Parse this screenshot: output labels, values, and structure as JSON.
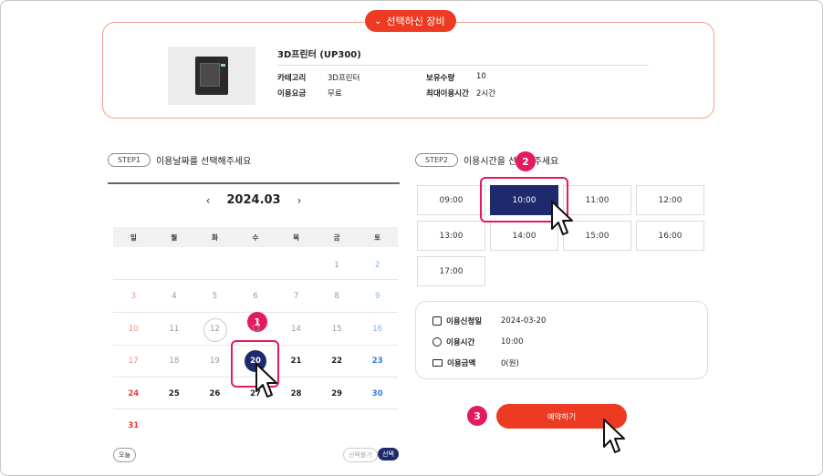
{
  "equipment": {
    "header": "선택하신 장비",
    "name": "3D프린터 (UP300)",
    "fields": {
      "category_label": "카테고리",
      "category_value": "3D프린터",
      "fee_label": "이용요금",
      "fee_value": "무료",
      "qty_label": "보유수량",
      "qty_value": "10",
      "maxtime_label": "최대이용시간",
      "maxtime_value": "2시간"
    }
  },
  "step1": {
    "badge": "STEP1",
    "label": "이용날짜를 선택해주세요"
  },
  "step2": {
    "badge": "STEP2",
    "label": "이용시간을 선택해주세요"
  },
  "calendar": {
    "month": "2024.03",
    "weekdays": [
      "일",
      "월",
      "화",
      "수",
      "목",
      "금",
      "토"
    ],
    "weeks": [
      [
        "",
        "",
        "",
        "",
        "",
        "1",
        "2"
      ],
      [
        "3",
        "4",
        "5",
        "6",
        "7",
        "8",
        "9"
      ],
      [
        "10",
        "11",
        "12",
        "13",
        "14",
        "15",
        "16"
      ],
      [
        "17",
        "18",
        "19",
        "20",
        "21",
        "22",
        "23"
      ],
      [
        "24",
        "25",
        "26",
        "27",
        "28",
        "29",
        "30"
      ],
      [
        "31",
        "",
        "",
        "",
        "",
        "",
        ""
      ]
    ],
    "today": "12",
    "selected": "20",
    "legend_today": "오늘",
    "legend_unavailable": "선택불가",
    "legend_selected": "선택"
  },
  "times": [
    "09:00",
    "10:00",
    "11:00",
    "12:00",
    "13:00",
    "14:00",
    "15:00",
    "16:00",
    "17:00"
  ],
  "selected_time": "10:00",
  "summary": {
    "date_label": "이용신청일",
    "date_value": "2024-03-20",
    "time_label": "이용시간",
    "time_value": "10:00",
    "amount_label": "이용금액",
    "amount_value": "0(원)"
  },
  "reserve_button": "예약하기",
  "markers": [
    "1",
    "2",
    "3"
  ],
  "colors": {
    "accent": "#ec3b22",
    "selected": "#1f2a6e",
    "highlight": "#e5195f"
  }
}
